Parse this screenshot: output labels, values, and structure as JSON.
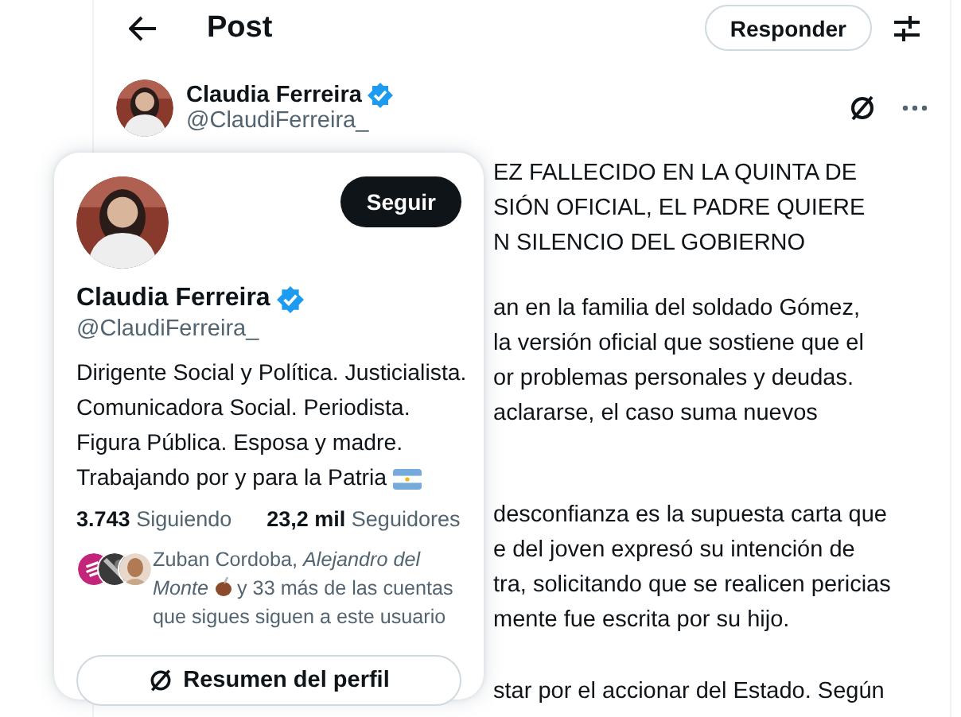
{
  "header": {
    "title": "Post",
    "reply_button": "Responder"
  },
  "author": {
    "name": "Claudia Ferreira",
    "handle": "@ClaudiFerreira_",
    "verified": true
  },
  "post_paragraphs": [
    {
      "lines": [
        "EZ FALLECIDO EN LA QUINTA DE",
        "SIÓN OFICIAL, EL PADRE QUIERE",
        "N SILENCIO DEL GOBIERNO"
      ]
    },
    {
      "lines": [
        "an en la familia del soldado Gómez,",
        "la versión oficial que sostiene que el",
        "or problemas personales y deudas.",
        "aclararse, el caso suma nuevos"
      ]
    },
    {
      "lines": [
        "desconfianza es la supuesta carta que",
        "e del joven expresó su intención de",
        "tra, solicitando que se realicen pericias",
        "mente fue escrita por su hijo."
      ]
    },
    {
      "lines": [
        "star por el accionar del Estado. Según"
      ]
    }
  ],
  "profile_card": {
    "name": "Claudia Ferreira",
    "handle": "@ClaudiFerreira_",
    "verified": true,
    "follow_button": "Seguir",
    "bio_lines": [
      "Dirigente Social y Política. Justicialista.",
      "Comunicadora Social. Periodista.",
      "Figura Pública. Esposa y madre.",
      "Trabajando por y para la Patria"
    ],
    "stats": [
      {
        "count": "3.743",
        "caption": "Siguiendo"
      },
      {
        "count": "23,2 mil",
        "caption": "Seguidores"
      }
    ],
    "followers_you_know_names": "Zuban Cordoba, *Alejandro del Monte*",
    "followers_you_know_rest": "y 33 más de las cuentas que sigues siguen a este usuario",
    "summary_button": "Resumen del perfil"
  }
}
